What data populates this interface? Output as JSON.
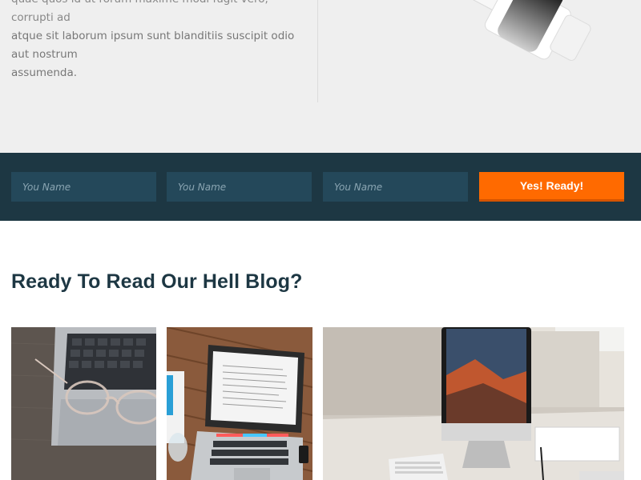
{
  "hero": {
    "line1": "quae quos id ut rorum maxime modi fugit vero, corrupti ad",
    "line2": "atque sit laborum ipsum sunt blanditiis suscipit odio aut nostrum",
    "line3": "assumenda."
  },
  "form": {
    "field1_placeholder": "You Name",
    "field2_placeholder": "You Name",
    "field3_placeholder": "You Name",
    "submit_label": "Yes! Ready!",
    "accent_color": "#ff6a00",
    "band_color": "#1d3743"
  },
  "blog": {
    "title": "Ready To Read Our Hell Blog?",
    "cards": [
      {
        "image": "laptop-with-glasses-photo"
      },
      {
        "image": "laptop-on-wooden-desk-photo"
      },
      {
        "image": "imac-on-white-desk-photo"
      }
    ]
  }
}
